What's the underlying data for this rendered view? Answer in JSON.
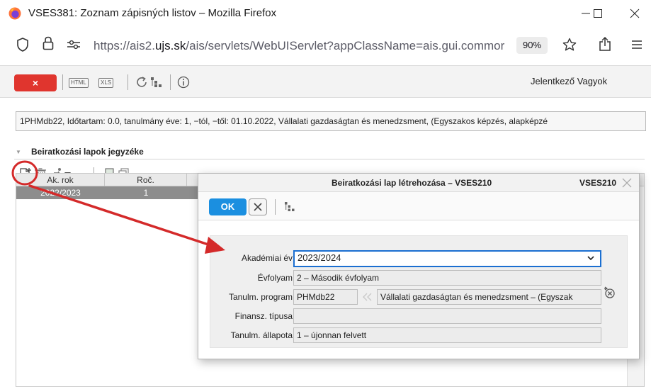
{
  "window": {
    "title": "VSES381: Zoznam zápisných listov – Mozilla Firefox"
  },
  "urlbar": {
    "url_prefix": "https://ais2.",
    "url_domain": "ujs.sk",
    "url_rest": "/ais/servlets/WebUIServlet?appClassName=ais.gui.commor",
    "zoom": "90%"
  },
  "app_toolbar": {
    "close_label": "×",
    "html_label": "HTML",
    "xls_label": "XLS",
    "user_name": "Jelentkező Vagyok"
  },
  "info_strip": "1PHMdb22, Időtartam: 0.0, tanulmány éve: 1, −tól, −től: 01.10.2022, Vállalati gazdaságtan és menedzsment, (Egyszakos képzés, alapképzé",
  "section": {
    "title": "Beiratkozási lapok jegyzéke"
  },
  "grid": {
    "columns": [
      "Ak. rok",
      "Roč."
    ],
    "rows": [
      [
        "2022/2023",
        "1"
      ]
    ]
  },
  "dialog": {
    "title": "Beiratkozási lap létrehozása – VSES210",
    "code": "VSES210",
    "ok_label": "OK",
    "fields": {
      "akademiai_ev_label": "Akadémiai év",
      "akademiai_ev_value": "2023/2024",
      "evfolyam_label": "Évfolyam",
      "evfolyam_value": "2 – Második évfolyam",
      "tanulm_program_label": "Tanulm. program",
      "tanulm_program_code": "PHMdb22",
      "tanulm_program_name": "Vállalati gazdaságtan és menedzsment – (Egyszak",
      "finansz_tipusa_label": "Finansz. típusa",
      "finansz_tipusa_value": "",
      "tanulm_allapota_label": "Tanulm. állapota",
      "tanulm_allapota_value": "1 – újonnan felvett"
    }
  },
  "colors": {
    "close_red": "#e0352e",
    "ok_blue": "#1b8fe0",
    "annotation_red": "#d42a2a",
    "selection_gray": "#8d8d8d"
  },
  "icons": [
    "firefox-logo-icon",
    "shield-icon",
    "lock-icon",
    "permissions-icon",
    "star-icon",
    "share-icon",
    "menu-icon",
    "refresh-icon",
    "hierarchy-icon",
    "info-icon",
    "new-document-icon",
    "delete-icon",
    "run-icon",
    "export-icon",
    "copy-icon",
    "close-icon",
    "dropdown-chevron-icon",
    "clear-icon",
    "scroll-up-icon"
  ]
}
